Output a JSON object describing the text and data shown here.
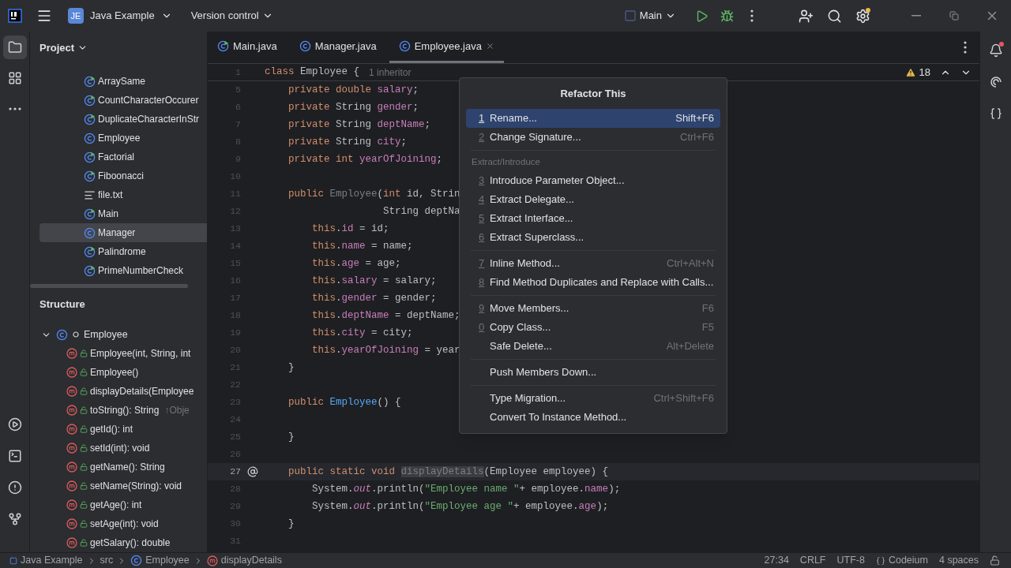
{
  "title_bar": {
    "project": {
      "badge": "JE",
      "name": "Java Example"
    },
    "vcs": "Version control",
    "run_config": "Main",
    "settings_badge": true
  },
  "left_tools": [
    {
      "kind": "project",
      "selected": true
    },
    {
      "kind": "structure",
      "selected": false
    },
    {
      "kind": "more",
      "selected": false
    }
  ],
  "bottom_tools": [
    {
      "kind": "run"
    },
    {
      "kind": "terminal"
    },
    {
      "kind": "problems"
    },
    {
      "kind": "git"
    }
  ],
  "project_panel": {
    "title": "Project",
    "items": [
      {
        "name": "ArraySame",
        "kind": "runnable",
        "selected": false
      },
      {
        "name": "CountCharacterOccurer",
        "kind": "runnable",
        "selected": false
      },
      {
        "name": "DuplicateCharacterInStr",
        "kind": "runnable",
        "selected": false
      },
      {
        "name": "Employee",
        "kind": "class",
        "selected": false
      },
      {
        "name": "Factorial",
        "kind": "runnable",
        "selected": false
      },
      {
        "name": "Fiboonacci",
        "kind": "runnable",
        "selected": false
      },
      {
        "name": "file.txt",
        "kind": "text",
        "selected": false
      },
      {
        "name": "Main",
        "kind": "runnable",
        "selected": false
      },
      {
        "name": "Manager",
        "kind": "class",
        "selected": true
      },
      {
        "name": "Palindrome",
        "kind": "runnable",
        "selected": false
      },
      {
        "name": "PrimeNumberCheck",
        "kind": "runnable",
        "selected": false
      }
    ]
  },
  "structure_panel": {
    "title": "Structure",
    "root": {
      "name": "Employee",
      "expanded": true,
      "children": [
        {
          "name": "Employee(int, String, int"
        },
        {
          "name": "Employee()"
        },
        {
          "name": "displayDetails(Employee"
        },
        {
          "name": "toString(): String",
          "hint": "↑Obje"
        },
        {
          "name": "getId(): int"
        },
        {
          "name": "setId(int): void"
        },
        {
          "name": "getName(): String"
        },
        {
          "name": "setName(String): void"
        },
        {
          "name": "getAge(): int"
        },
        {
          "name": "setAge(int): void"
        },
        {
          "name": "getSalary(): double"
        }
      ]
    }
  },
  "editor": {
    "tabs": [
      {
        "label": "Main.java",
        "kind": "runnable",
        "selected": false
      },
      {
        "label": "Manager.java",
        "kind": "class",
        "selected": false
      },
      {
        "label": "Employee.java",
        "kind": "class",
        "selected": true
      }
    ],
    "warnings": "18",
    "sticky_line": {
      "number": "1",
      "tokens": [
        {
          "kind": "kw",
          "text": "class "
        },
        {
          "kind": "plain",
          "text": "Employee {"
        }
      ],
      "hint": "1 inheritor"
    },
    "lines": [
      {
        "number": "5",
        "current": false,
        "tokens": [
          {
            "kind": "kw",
            "text": "    private double "
          },
          {
            "kind": "field",
            "text": "salary"
          },
          {
            "kind": "plain",
            "text": ";"
          }
        ]
      },
      {
        "number": "6",
        "current": false,
        "tokens": [
          {
            "kind": "kw",
            "text": "    private "
          },
          {
            "kind": "plain",
            "text": "String "
          },
          {
            "kind": "field",
            "text": "gender"
          },
          {
            "kind": "plain",
            "text": ";"
          }
        ]
      },
      {
        "number": "7",
        "current": false,
        "tokens": [
          {
            "kind": "kw",
            "text": "    private "
          },
          {
            "kind": "plain",
            "text": "String "
          },
          {
            "kind": "field",
            "text": "deptName"
          },
          {
            "kind": "plain",
            "text": ";"
          }
        ]
      },
      {
        "number": "8",
        "current": false,
        "tokens": [
          {
            "kind": "kw",
            "text": "    private "
          },
          {
            "kind": "plain",
            "text": "String "
          },
          {
            "kind": "field",
            "text": "city"
          },
          {
            "kind": "plain",
            "text": ";"
          }
        ]
      },
      {
        "number": "9",
        "current": false,
        "tokens": [
          {
            "kind": "kw",
            "text": "    private int "
          },
          {
            "kind": "field",
            "text": "yearOfJoining"
          },
          {
            "kind": "plain",
            "text": ";"
          }
        ]
      },
      {
        "number": "10",
        "current": false
      },
      {
        "number": "11",
        "current": false,
        "tokens": [
          {
            "kind": "kw",
            "text": "    public "
          },
          {
            "kind": "unused",
            "text": "Employee"
          },
          {
            "kind": "plain",
            "text": "("
          },
          {
            "kind": "kw",
            "text": "int "
          },
          {
            "kind": "plain",
            "text": "id, Strin"
          }
        ]
      },
      {
        "number": "12",
        "current": false,
        "tokens": [
          {
            "kind": "plain",
            "text": "                    String deptNa"
          }
        ]
      },
      {
        "number": "13",
        "current": false,
        "tokens": [
          {
            "kind": "kw",
            "text": "        this"
          },
          {
            "kind": "plain",
            "text": "."
          },
          {
            "kind": "field",
            "text": "id"
          },
          {
            "kind": "plain",
            "text": " = id;"
          }
        ]
      },
      {
        "number": "14",
        "current": false,
        "tokens": [
          {
            "kind": "kw",
            "text": "        this"
          },
          {
            "kind": "plain",
            "text": "."
          },
          {
            "kind": "field",
            "text": "name"
          },
          {
            "kind": "plain",
            "text": " = name;"
          }
        ]
      },
      {
        "number": "15",
        "current": false,
        "tokens": [
          {
            "kind": "kw",
            "text": "        this"
          },
          {
            "kind": "plain",
            "text": "."
          },
          {
            "kind": "field",
            "text": "age"
          },
          {
            "kind": "plain",
            "text": " = age;"
          }
        ]
      },
      {
        "number": "16",
        "current": false,
        "tokens": [
          {
            "kind": "kw",
            "text": "        this"
          },
          {
            "kind": "plain",
            "text": "."
          },
          {
            "kind": "field",
            "text": "salary"
          },
          {
            "kind": "plain",
            "text": " = salary;"
          }
        ]
      },
      {
        "number": "17",
        "current": false,
        "tokens": [
          {
            "kind": "kw",
            "text": "        this"
          },
          {
            "kind": "plain",
            "text": "."
          },
          {
            "kind": "field",
            "text": "gender"
          },
          {
            "kind": "plain",
            "text": " = gender;"
          }
        ]
      },
      {
        "number": "18",
        "current": false,
        "tokens": [
          {
            "kind": "kw",
            "text": "        this"
          },
          {
            "kind": "plain",
            "text": "."
          },
          {
            "kind": "field",
            "text": "deptName"
          },
          {
            "kind": "plain",
            "text": " = deptName;"
          }
        ]
      },
      {
        "number": "19",
        "current": false,
        "tokens": [
          {
            "kind": "kw",
            "text": "        this"
          },
          {
            "kind": "plain",
            "text": "."
          },
          {
            "kind": "field",
            "text": "city"
          },
          {
            "kind": "plain",
            "text": " = city;"
          }
        ]
      },
      {
        "number": "20",
        "current": false,
        "tokens": [
          {
            "kind": "kw",
            "text": "        this"
          },
          {
            "kind": "plain",
            "text": "."
          },
          {
            "kind": "field",
            "text": "yearOfJoining"
          },
          {
            "kind": "plain",
            "text": " = year"
          }
        ]
      },
      {
        "number": "21",
        "current": false,
        "tokens": [
          {
            "kind": "plain",
            "text": "    }"
          }
        ]
      },
      {
        "number": "22",
        "current": false
      },
      {
        "number": "23",
        "current": false,
        "tokens": [
          {
            "kind": "kw",
            "text": "    public "
          },
          {
            "kind": "method",
            "text": "Employee"
          },
          {
            "kind": "plain",
            "text": "() {"
          }
        ]
      },
      {
        "number": "24",
        "current": false
      },
      {
        "number": "25",
        "current": false,
        "tokens": [
          {
            "kind": "plain",
            "text": "    }"
          }
        ]
      },
      {
        "number": "26",
        "current": false
      },
      {
        "number": "27",
        "current": true,
        "gutter": {
          "kind": "override"
        },
        "tokens": [
          {
            "kind": "kw",
            "text": "    public static void "
          },
          {
            "kind": "unused_mark",
            "text": "displayDetails"
          },
          {
            "kind": "plain",
            "text": "(Employee employee) {"
          }
        ]
      },
      {
        "number": "28",
        "current": false,
        "tokens": [
          {
            "kind": "plain",
            "text": "        System."
          },
          {
            "kind": "static",
            "text": "out"
          },
          {
            "kind": "plain",
            "text": ".println("
          },
          {
            "kind": "str",
            "text": "\"Employee name \""
          },
          {
            "kind": "plain",
            "text": "+ employee."
          },
          {
            "kind": "field",
            "text": "name"
          },
          {
            "kind": "plain",
            "text": ");"
          }
        ]
      },
      {
        "number": "29",
        "current": false,
        "tokens": [
          {
            "kind": "plain",
            "text": "        System."
          },
          {
            "kind": "static",
            "text": "out"
          },
          {
            "kind": "plain",
            "text": ".println("
          },
          {
            "kind": "str",
            "text": "\"Employee age \""
          },
          {
            "kind": "plain",
            "text": "+ employee."
          },
          {
            "kind": "field",
            "text": "age"
          },
          {
            "kind": "plain",
            "text": ");"
          }
        ]
      },
      {
        "number": "30",
        "current": false,
        "tokens": [
          {
            "kind": "plain",
            "text": "    }"
          }
        ]
      },
      {
        "number": "31",
        "current": false
      }
    ]
  },
  "popup": {
    "title": "Refactor This",
    "items": [
      {
        "kind": "item",
        "number": "1",
        "label": "Rename...",
        "shortcut": "Shift+F6",
        "selected": true
      },
      {
        "kind": "item",
        "number": "2",
        "label": "Change Signature...",
        "shortcut": "Ctrl+F6",
        "selected": false
      },
      {
        "kind": "separator"
      },
      {
        "kind": "header",
        "label": "Extract/Introduce"
      },
      {
        "kind": "item",
        "number": "3",
        "label": "Introduce Parameter Object...",
        "selected": false
      },
      {
        "kind": "item",
        "number": "4",
        "label": "Extract Delegate...",
        "selected": false
      },
      {
        "kind": "item",
        "number": "5",
        "label": "Extract Interface...",
        "selected": false
      },
      {
        "kind": "item",
        "number": "6",
        "label": "Extract Superclass...",
        "selected": false
      },
      {
        "kind": "separator"
      },
      {
        "kind": "item",
        "number": "7",
        "label": "Inline Method...",
        "shortcut": "Ctrl+Alt+N",
        "selected": false
      },
      {
        "kind": "item",
        "number": "8",
        "label": "Find Method Duplicates and Replace with Calls...",
        "selected": false
      },
      {
        "kind": "separator"
      },
      {
        "kind": "item",
        "number": "9",
        "label": "Move Members...",
        "shortcut": "F6",
        "selected": false
      },
      {
        "kind": "item",
        "number": "0",
        "label": "Copy Class...",
        "shortcut": "F5",
        "selected": false
      },
      {
        "kind": "item",
        "label": "Safe Delete...",
        "shortcut": "Alt+Delete",
        "selected": false
      },
      {
        "kind": "separator"
      },
      {
        "kind": "item",
        "label": "Push Members Down...",
        "selected": false
      },
      {
        "kind": "separator"
      },
      {
        "kind": "item",
        "label": "Type Migration...",
        "shortcut": "Ctrl+Shift+F6",
        "selected": false
      },
      {
        "kind": "item",
        "label": "Convert To Instance Method...",
        "selected": false
      }
    ]
  },
  "right_tools": {
    "notifications_unread": true
  },
  "status_bar": {
    "breadcrumbs": [
      {
        "kind": "module",
        "text": "Java Example"
      },
      {
        "kind": "folder",
        "text": "src"
      },
      {
        "kind": "class",
        "text": "Employee"
      },
      {
        "kind": "method",
        "text": "displayDetails"
      }
    ],
    "items": [
      {
        "kind": "text",
        "text": "27:34"
      },
      {
        "kind": "text",
        "text": "CRLF"
      },
      {
        "kind": "text",
        "text": "UTF-8"
      },
      {
        "kind": "plugin",
        "text": "Codeium"
      },
      {
        "kind": "text",
        "text": "4 spaces"
      },
      {
        "kind": "lock"
      }
    ]
  }
}
